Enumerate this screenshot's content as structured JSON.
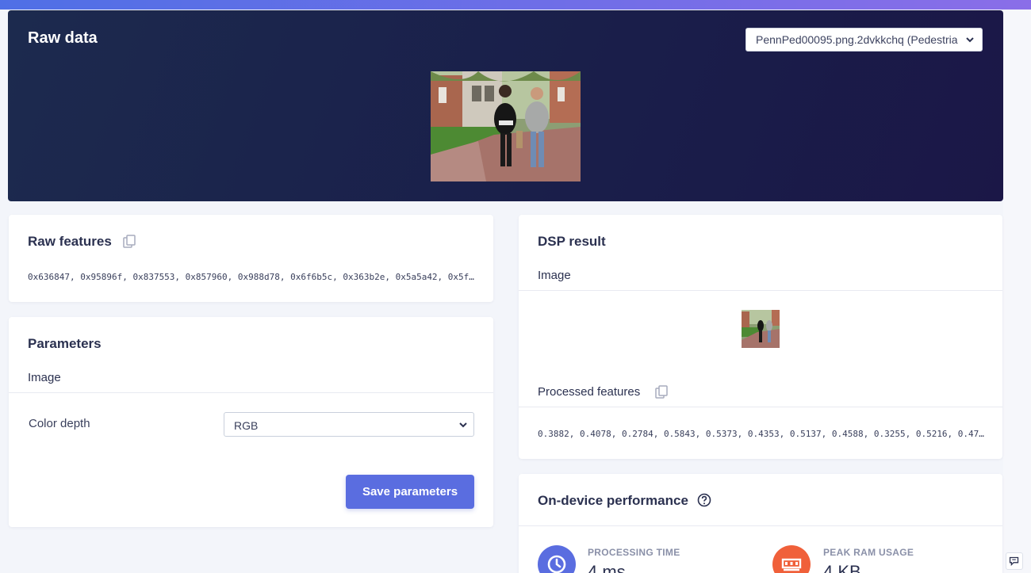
{
  "hero": {
    "title": "Raw data",
    "sample_select": "PennPed00095.png.2dvkkchq (Pedestria"
  },
  "raw_features": {
    "title": "Raw features",
    "values": "0x636847, 0x95896f, 0x837553, 0x857960, 0x988d78, 0x6f6b5c, 0x363b2e, 0x5a5a42, 0x5f…"
  },
  "parameters": {
    "title": "Parameters",
    "section": "Image",
    "color_depth_label": "Color depth",
    "color_depth_value": "RGB",
    "save_label": "Save parameters"
  },
  "dsp_result": {
    "title": "DSP result",
    "image_label": "Image",
    "processed_label": "Processed features",
    "processed_values": "0.3882, 0.4078, 0.2784, 0.5843, 0.5373, 0.4353, 0.5137, 0.4588, 0.3255, 0.5216, 0.47…"
  },
  "performance": {
    "title": "On-device performance",
    "processing_label": "PROCESSING TIME",
    "processing_value": "4 ms.",
    "ram_label": "PEAK RAM USAGE",
    "ram_value": "4 KB"
  },
  "colors": {
    "accent": "#5a6de0",
    "hero_bg": "#1a1e4a",
    "processing_circle": "#5a6de0",
    "ram_circle": "#f0603a"
  }
}
